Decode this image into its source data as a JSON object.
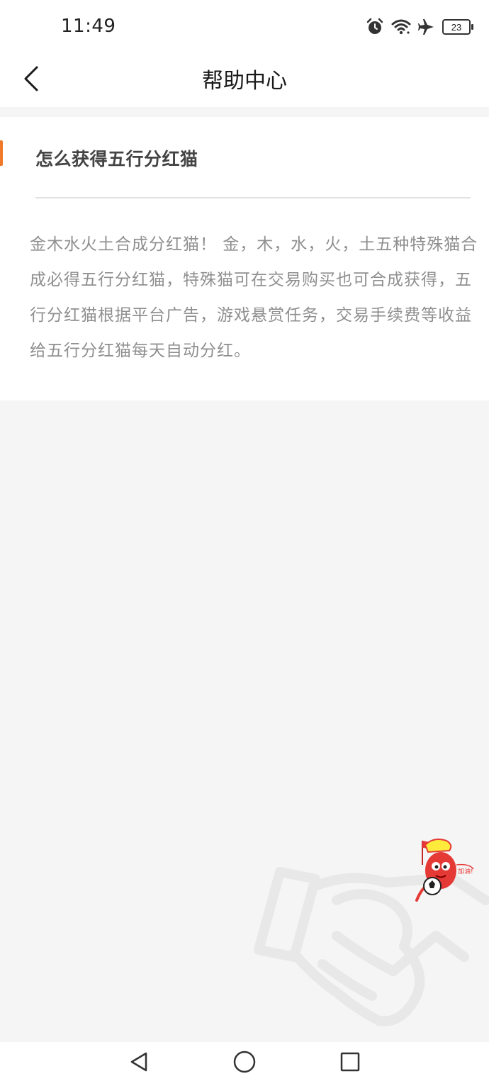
{
  "status_bar": {
    "time": "11:49",
    "battery": "23",
    "icons": [
      "alarm-icon",
      "wifi-icon",
      "airplane-icon",
      "battery-icon"
    ]
  },
  "header": {
    "title": "帮助中心",
    "back_icon": "chevron-left-icon"
  },
  "faq": {
    "question": "怎么获得五行分红猫",
    "answer": "金木水火土合成分红猫！ 金，木，水，火，土五种特殊猫合成必得五行分红猫，特殊猫可在交易购买也可合成获得，五行分红猫根据平台广告，游戏悬赏任务，交易手续费等收益给五行分红猫每天自动分红。"
  },
  "nav_bar": {
    "buttons": [
      "back-triangle-icon",
      "home-circle-icon",
      "recents-square-icon"
    ]
  },
  "colors": {
    "accent": "#f07a2a",
    "background": "#f5f5f5",
    "card": "#ffffff",
    "answer_text": "#8f8f8f"
  }
}
